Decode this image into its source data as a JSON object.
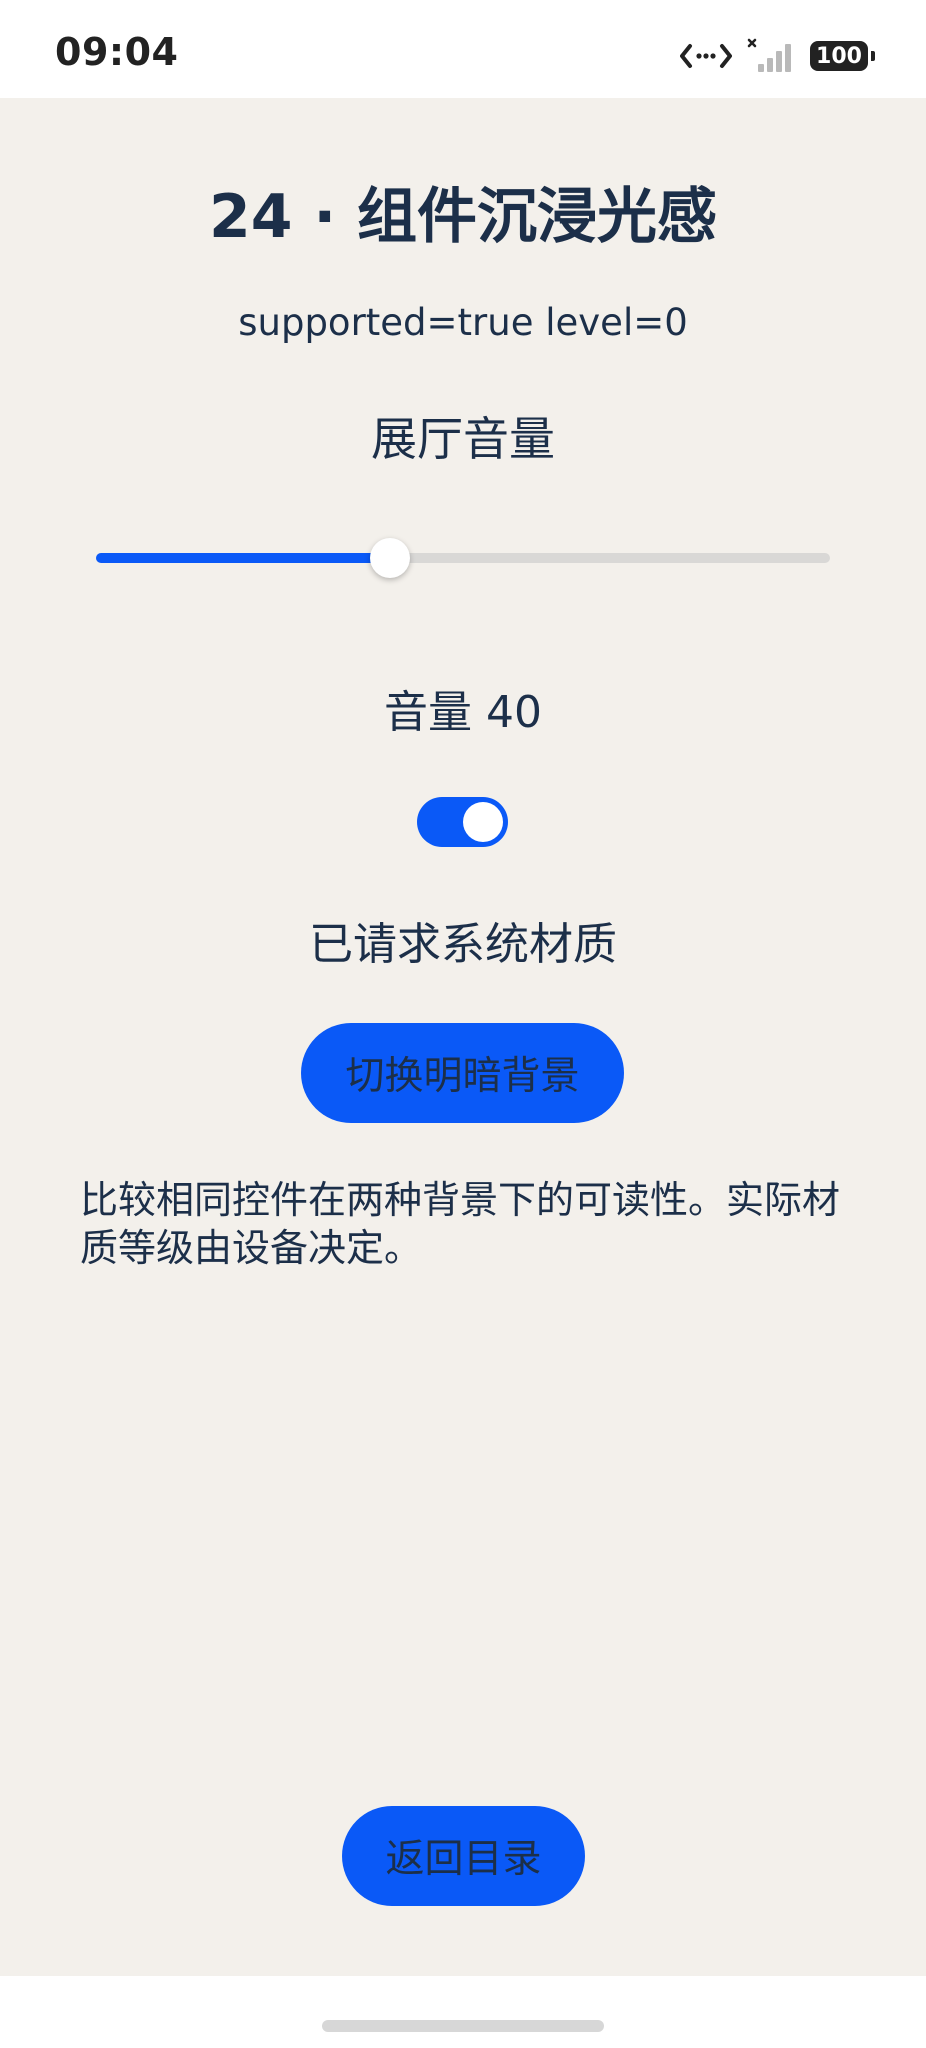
{
  "status_bar": {
    "time": "09:04",
    "battery": "100",
    "icons": [
      "data-transfer-icon",
      "signal-icon",
      "battery-icon"
    ]
  },
  "page": {
    "title": "24 · 组件沉浸光感",
    "subtitle": "supported=true level=0",
    "section_label": "展厅音量",
    "slider": {
      "value": 40,
      "min": 0,
      "max": 100
    },
    "volume_text": "音量 40",
    "toggle": {
      "on": true
    },
    "toggle_status": "已请求系统材质",
    "switch_bg_button": "切换明暗背景",
    "description": "比较相同控件在两种背景下的可读性。实际材质等级由设备决定。",
    "back_button": "返回目录"
  },
  "colors": {
    "accent": "#0a59f7",
    "background": "#f3f0eb",
    "text": "#1c2f49",
    "track": "#d9d8d6"
  }
}
